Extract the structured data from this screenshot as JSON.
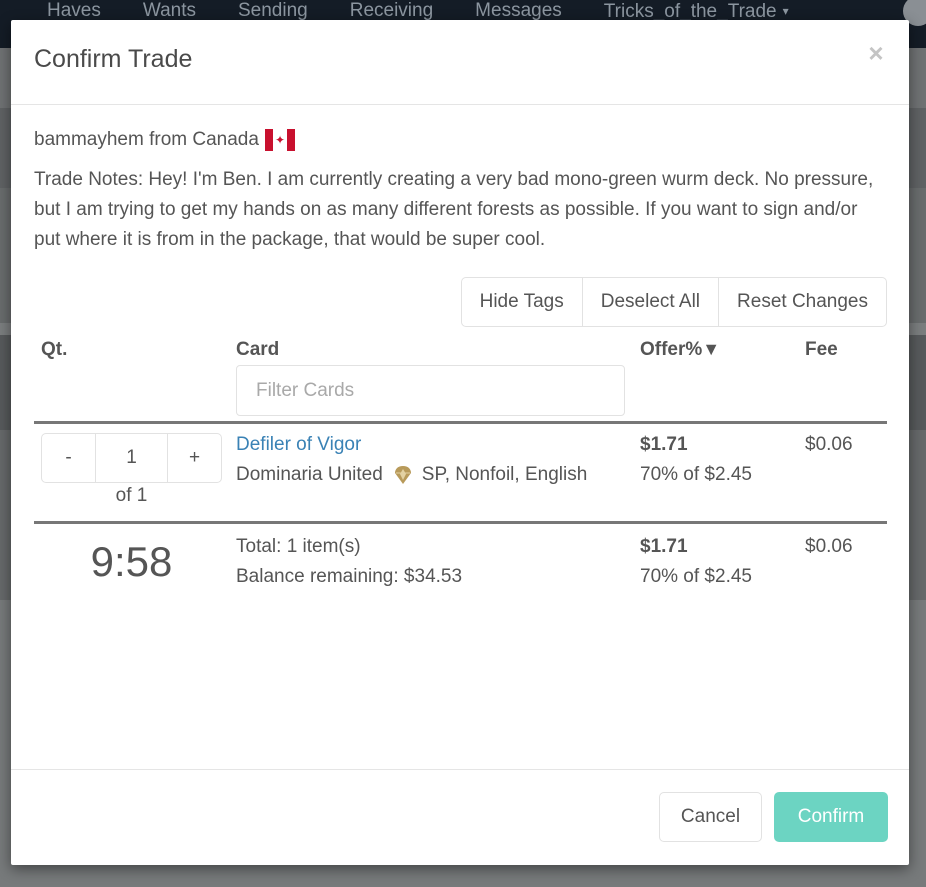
{
  "background": {
    "nav_items": [
      "Haves",
      "Wants",
      "Sending",
      "Receiving",
      "Messages",
      "Tricks_of_the_Trade"
    ],
    "dropdown_caret": "▾"
  },
  "modal": {
    "title": "Confirm Trade",
    "close_label": "×",
    "seller": {
      "text": "bammayhem from Canada",
      "country_flag_icon": "canada-flag"
    },
    "trade_notes": "Trade Notes: Hey! I'm Ben. I am currently creating a very bad mono-green wurm deck. No pressure, but I am trying to get my hands on as many different forests as possible. If you want to sign and/or put where it is from in the package, that would be super cool.",
    "actions": {
      "hide_tags": "Hide Tags",
      "deselect_all": "Deselect All",
      "reset_changes": "Reset Changes"
    },
    "table": {
      "headers": {
        "qty": "Qt.",
        "card": "Card",
        "offer": "Offer%",
        "offer_sort_icon": "▼",
        "fee": "Fee"
      },
      "filter_placeholder": "Filter Cards",
      "filter_value": "",
      "rows": [
        {
          "qty_minus": "-",
          "qty_value": "1",
          "qty_plus": "+",
          "qty_of": "of 1",
          "card_name": "Defiler of Vigor",
          "set_name": "Dominaria United",
          "set_icon": "dominaria-united-set-icon",
          "set_rarity_color": "#b89a5a",
          "condition": "SP, Nonfoil, English",
          "offer_price": "$1.71",
          "offer_detail": "70% of $2.45",
          "fee": "$0.06"
        }
      ],
      "footer": {
        "timer": "9:58",
        "total": "Total: 1 item(s)",
        "balance": "Balance remaining: $34.53",
        "offer_price": "$1.71",
        "offer_detail": "70% of $2.45",
        "fee": "$0.06"
      }
    },
    "buttons": {
      "cancel": "Cancel",
      "confirm": "Confirm"
    },
    "colors": {
      "link": "#3a82b5",
      "confirm": "#6cd4c2",
      "flag_red": "#c8102e"
    }
  }
}
